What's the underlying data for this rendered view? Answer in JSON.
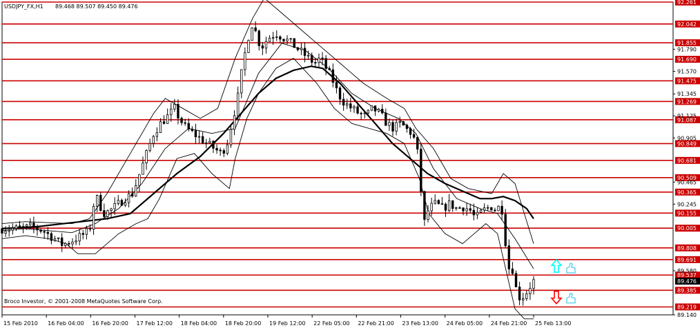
{
  "header": {
    "symbol": "USDJPY_FX,H1",
    "ohlc": "89.468 89.507 89.450 89.476"
  },
  "footer": {
    "copyright": "Broco Investor, © 2001-2008 MetaQuotes Software Corp."
  },
  "colors": {
    "level_line": "#cc0000",
    "level_tag": "#cc0000",
    "current_tag": "#000000",
    "buy_arrow": "#00ffff",
    "sell_arrow": "#ff0000",
    "hand_icon": "#55ccee"
  },
  "icons": {
    "buy": "up-arrow-icon",
    "sell": "down-arrow-icon",
    "hand": "thumbs-up-icon"
  },
  "chart_data": {
    "type": "candlestick",
    "symbol": "USDJPY_FX",
    "timeframe": "H1",
    "ylim": [
      89.14,
      92.261
    ],
    "x_tick_labels": [
      "15 Feb 2010",
      "16 Feb 04:00",
      "16 Feb 20:00",
      "17 Feb 12:00",
      "18 Feb 04:00",
      "18 Feb 20:00",
      "19 Feb 12:00",
      "22 Feb 05:00",
      "22 Feb 21:00",
      "23 Feb 13:00",
      "24 Feb 05:00",
      "24 Feb 21:00",
      "25 Feb 13:00"
    ],
    "y_tick_labels": [
      "92.261",
      "92.042",
      "91.855",
      "91.790",
      "91.690",
      "91.570",
      "91.475",
      "91.345",
      "91.269",
      "91.125",
      "91.087",
      "90.905",
      "90.849",
      "90.681",
      "90.509",
      "90.465",
      "90.365",
      "90.245",
      "90.155",
      "90.005",
      "89.808",
      "89.691",
      "89.580",
      "89.537",
      "89.476",
      "89.385",
      "89.219",
      "89.140"
    ],
    "red_level_tags": [
      "92.261",
      "92.042",
      "91.855",
      "91.690",
      "91.475",
      "91.269",
      "91.087",
      "90.849",
      "90.681",
      "90.509",
      "90.365",
      "90.155",
      "90.005",
      "89.808",
      "89.691",
      "89.537",
      "89.385",
      "89.219"
    ],
    "current_price": "89.476",
    "red_levels": [
      92.261,
      92.042,
      91.855,
      91.69,
      91.475,
      91.269,
      91.087,
      90.849,
      90.681,
      90.509,
      90.365,
      90.155,
      90.005,
      89.808,
      89.691,
      89.537,
      89.385,
      89.219
    ],
    "plain_ticks": [
      91.79,
      91.57,
      91.345,
      91.125,
      90.905,
      90.465,
      90.245,
      89.58,
      89.14
    ],
    "price_path": [
      [
        0,
        90.0
      ],
      [
        15,
        90.0
      ],
      [
        25,
        90.02
      ],
      [
        35,
        89.98
      ],
      [
        45,
        89.9
      ],
      [
        52,
        89.84
      ],
      [
        60,
        89.88
      ],
      [
        68,
        89.93
      ],
      [
        75,
        89.98
      ],
      [
        78,
        90.2
      ],
      [
        80,
        90.35
      ],
      [
        83,
        90.25
      ],
      [
        88,
        90.15
      ],
      [
        95,
        90.2
      ],
      [
        100,
        90.25
      ],
      [
        105,
        90.3
      ],
      [
        112,
        90.35
      ],
      [
        118,
        90.55
      ],
      [
        124,
        90.75
      ],
      [
        130,
        90.95
      ],
      [
        136,
        91.05
      ],
      [
        142,
        91.12
      ],
      [
        148,
        91.2
      ],
      [
        152,
        91.1
      ],
      [
        158,
        91.0
      ],
      [
        164,
        90.95
      ],
      [
        170,
        90.9
      ],
      [
        176,
        90.85
      ],
      [
        182,
        90.8
      ],
      [
        188,
        90.75
      ],
      [
        193,
        90.85
      ],
      [
        198,
        91.1
      ],
      [
        203,
        91.35
      ],
      [
        206,
        91.6
      ],
      [
        210,
        91.85
      ],
      [
        214,
        92.05
      ],
      [
        218,
        91.95
      ],
      [
        222,
        91.8
      ],
      [
        228,
        91.9
      ],
      [
        235,
        91.95
      ],
      [
        242,
        91.9
      ],
      [
        248,
        91.85
      ],
      [
        253,
        91.8
      ],
      [
        258,
        91.75
      ],
      [
        263,
        91.7
      ],
      [
        268,
        91.65
      ],
      [
        273,
        91.7
      ],
      [
        278,
        91.6
      ],
      [
        283,
        91.5
      ],
      [
        288,
        91.35
      ],
      [
        294,
        91.25
      ],
      [
        300,
        91.2
      ],
      [
        306,
        91.15
      ],
      [
        312,
        91.12
      ],
      [
        318,
        91.2
      ],
      [
        324,
        91.15
      ],
      [
        330,
        91.05
      ],
      [
        336,
        91.0
      ],
      [
        342,
        91.05
      ],
      [
        348,
        90.98
      ],
      [
        352,
        90.95
      ],
      [
        356,
        90.8
      ],
      [
        358,
        90.55
      ],
      [
        360,
        90.3
      ],
      [
        362,
        90.05
      ],
      [
        366,
        90.2
      ],
      [
        372,
        90.25
      ],
      [
        378,
        90.2
      ],
      [
        384,
        90.25
      ],
      [
        390,
        90.2
      ],
      [
        396,
        90.22
      ],
      [
        402,
        90.18
      ],
      [
        406,
        90.1
      ],
      [
        410,
        90.15
      ],
      [
        415,
        90.2
      ],
      [
        420,
        90.22
      ],
      [
        424,
        90.18
      ],
      [
        428,
        90.25
      ],
      [
        430,
        90.1
      ],
      [
        432,
        89.85
      ],
      [
        434,
        89.65
      ],
      [
        436,
        89.55
      ],
      [
        438,
        89.6
      ],
      [
        440,
        89.45
      ],
      [
        442,
        89.35
      ],
      [
        445,
        89.3
      ],
      [
        449,
        89.35
      ],
      [
        452,
        89.4
      ],
      [
        455,
        89.48
      ],
      [
        456,
        89.476
      ]
    ],
    "bollinger_mid": [
      [
        0,
        89.98
      ],
      [
        20,
        90.0
      ],
      [
        40,
        89.98
      ],
      [
        60,
        89.96
      ],
      [
        80,
        90.05
      ],
      [
        100,
        90.2
      ],
      [
        120,
        90.45
      ],
      [
        140,
        90.8
      ],
      [
        160,
        91.0
      ],
      [
        180,
        90.95
      ],
      [
        200,
        91.0
      ],
      [
        220,
        91.55
      ],
      [
        240,
        91.85
      ],
      [
        260,
        91.78
      ],
      [
        280,
        91.6
      ],
      [
        300,
        91.35
      ],
      [
        320,
        91.2
      ],
      [
        340,
        91.1
      ],
      [
        355,
        90.95
      ],
      [
        370,
        90.6
      ],
      [
        390,
        90.3
      ],
      [
        410,
        90.2
      ],
      [
        425,
        90.15
      ],
      [
        440,
        89.9
      ],
      [
        456,
        89.6
      ]
    ],
    "bollinger_upper": [
      [
        0,
        90.05
      ],
      [
        20,
        90.07
      ],
      [
        40,
        90.06
      ],
      [
        60,
        90.05
      ],
      [
        75,
        90.1
      ],
      [
        90,
        90.35
      ],
      [
        110,
        90.75
      ],
      [
        130,
        91.15
      ],
      [
        140,
        91.3
      ],
      [
        155,
        91.2
      ],
      [
        170,
        91.1
      ],
      [
        185,
        91.2
      ],
      [
        200,
        91.7
      ],
      [
        215,
        92.1
      ],
      [
        225,
        92.3
      ],
      [
        240,
        92.15
      ],
      [
        255,
        92.0
      ],
      [
        270,
        91.85
      ],
      [
        290,
        91.65
      ],
      [
        310,
        91.45
      ],
      [
        330,
        91.3
      ],
      [
        345,
        91.2
      ],
      [
        355,
        91.0
      ],
      [
        370,
        90.8
      ],
      [
        385,
        90.5
      ],
      [
        400,
        90.4
      ],
      [
        420,
        90.35
      ],
      [
        430,
        90.55
      ],
      [
        440,
        90.45
      ],
      [
        456,
        89.85
      ]
    ],
    "bollinger_lower": [
      [
        0,
        89.9
      ],
      [
        20,
        89.93
      ],
      [
        40,
        89.9
      ],
      [
        55,
        89.85
      ],
      [
        65,
        89.75
      ],
      [
        80,
        89.75
      ],
      [
        100,
        89.95
      ],
      [
        115,
        90.05
      ],
      [
        125,
        90.1
      ],
      [
        135,
        90.3
      ],
      [
        150,
        90.7
      ],
      [
        165,
        90.75
      ],
      [
        180,
        90.55
      ],
      [
        195,
        90.4
      ],
      [
        200,
        90.7
      ],
      [
        210,
        91.1
      ],
      [
        220,
        91.35
      ],
      [
        235,
        91.6
      ],
      [
        250,
        91.7
      ],
      [
        270,
        91.45
      ],
      [
        285,
        91.2
      ],
      [
        300,
        91.05
      ],
      [
        315,
        91.0
      ],
      [
        330,
        90.95
      ],
      [
        345,
        90.85
      ],
      [
        358,
        90.5
      ],
      [
        366,
        90.15
      ],
      [
        380,
        89.95
      ],
      [
        395,
        89.85
      ],
      [
        405,
        89.95
      ],
      [
        415,
        90.05
      ],
      [
        425,
        89.95
      ],
      [
        432,
        89.6
      ],
      [
        440,
        89.2
      ],
      [
        448,
        89.1
      ],
      [
        456,
        89.1
      ]
    ],
    "moving_average": [
      [
        0,
        90.0
      ],
      [
        30,
        90.02
      ],
      [
        60,
        90.06
      ],
      [
        90,
        90.1
      ],
      [
        110,
        90.15
      ],
      [
        130,
        90.35
      ],
      [
        150,
        90.55
      ],
      [
        170,
        90.72
      ],
      [
        190,
        90.95
      ],
      [
        205,
        91.15
      ],
      [
        220,
        91.35
      ],
      [
        235,
        91.5
      ],
      [
        250,
        91.58
      ],
      [
        265,
        91.62
      ],
      [
        275,
        91.6
      ],
      [
        290,
        91.45
      ],
      [
        305,
        91.25
      ],
      [
        320,
        91.05
      ],
      [
        335,
        90.85
      ],
      [
        350,
        90.7
      ],
      [
        365,
        90.55
      ],
      [
        380,
        90.45
      ],
      [
        390,
        90.4
      ],
      [
        400,
        90.35
      ],
      [
        410,
        90.3
      ],
      [
        420,
        90.3
      ],
      [
        430,
        90.32
      ],
      [
        440,
        90.28
      ],
      [
        450,
        90.2
      ],
      [
        456,
        90.1
      ]
    ],
    "signals": [
      {
        "kind": "buy",
        "price": 89.62,
        "hand_price": 89.6
      },
      {
        "kind": "sell",
        "price": 89.32,
        "hand_price": 89.3
      }
    ]
  }
}
